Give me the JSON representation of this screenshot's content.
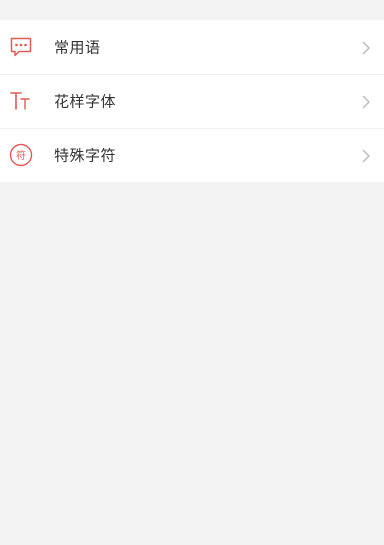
{
  "colors": {
    "accent": "#e05a56",
    "background": "#f3f3f3",
    "item_background": "#ffffff",
    "text": "#333333",
    "chevron": "#b8b8b8"
  },
  "menu": {
    "items": [
      {
        "label": "常用语",
        "icon": "speech-bubble-icon"
      },
      {
        "label": "花样字体",
        "icon": "text-size-icon"
      },
      {
        "label": "特殊字符",
        "icon": "special-character-icon",
        "icon_text": "符"
      }
    ]
  }
}
